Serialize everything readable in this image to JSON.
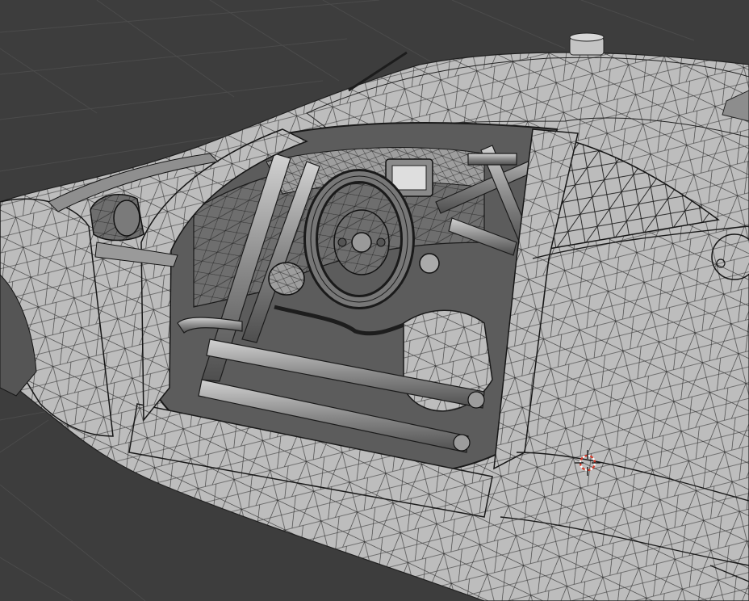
{
  "viewport": {
    "kind": "3d-viewport",
    "shading_mode": "wireframe-overlay",
    "model": "race-car-cockpit",
    "background_color": "#3d3d3d",
    "grid_color": "#4a4a4a",
    "body_color": "#b9b9b9",
    "wire_color": "#1e1e1e",
    "cursor_icon": "3d-cursor-icon",
    "cursor_colors": [
      "#d43a2a",
      "#ffffff"
    ]
  }
}
